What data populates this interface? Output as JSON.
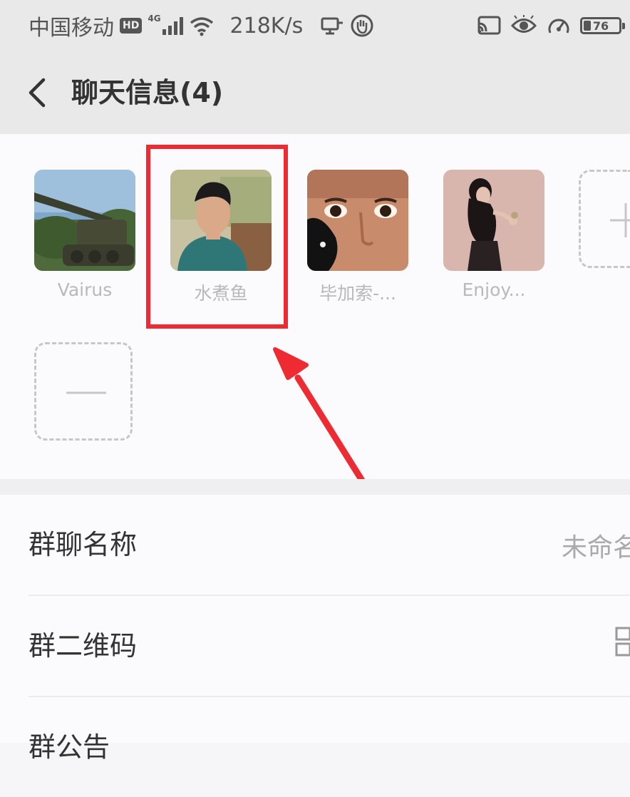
{
  "status_bar": {
    "carrier": "中国移动",
    "hd_badge": "HD",
    "network_type": "4G",
    "speed": "218K/s",
    "battery_level": "76"
  },
  "header": {
    "title": "聊天信息(4)"
  },
  "members": [
    {
      "name": "Vairus",
      "avatar": "tank-avatar"
    },
    {
      "name": "水煮鱼",
      "avatar": "man-avatar"
    },
    {
      "name": "毕加索-...",
      "avatar": "face-avatar"
    },
    {
      "name": "Enjoy...",
      "avatar": "woman-avatar"
    }
  ],
  "settings": {
    "group_name": {
      "label": "群聊名称",
      "value": "未命名"
    },
    "group_qr": {
      "label": "群二维码"
    },
    "group_notice": {
      "label": "群公告"
    }
  },
  "colors": {
    "highlight": "#ee2b33",
    "background": "#fbfafc",
    "header": "#e9e9ea"
  }
}
